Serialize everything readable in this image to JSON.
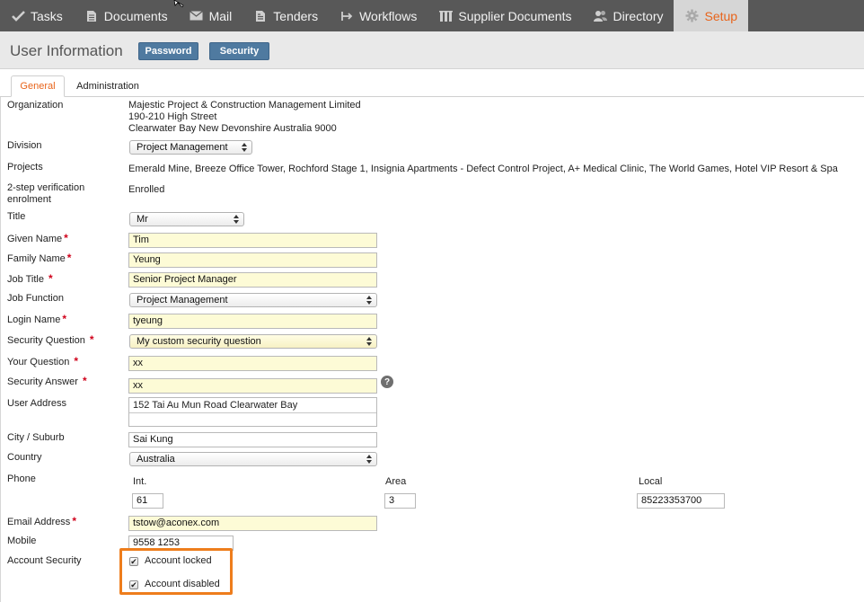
{
  "nav": {
    "items": [
      {
        "label": "Tasks",
        "icon": "check-icon"
      },
      {
        "label": "Documents",
        "icon": "document-icon"
      },
      {
        "label": "Mail",
        "icon": "mail-icon"
      },
      {
        "label": "Tenders",
        "icon": "tender-icon"
      },
      {
        "label": "Workflows",
        "icon": "workflow-icon"
      },
      {
        "label": "Supplier Documents",
        "icon": "supplier-documents-icon"
      },
      {
        "label": "Directory",
        "icon": "people-icon"
      },
      {
        "label": "Setup",
        "icon": "gear-icon",
        "active": true
      }
    ]
  },
  "header": {
    "title": "User Information",
    "password_btn": "Password",
    "security_btn": "Security"
  },
  "tabs": {
    "general": "General",
    "administration": "Administration"
  },
  "form": {
    "organization_label": "Organization",
    "organization_name": "Majestic Project & Construction Management Limited",
    "organization_address1": "190-210 High Street",
    "organization_address2": "Clearwater Bay New Devonshire Australia 9000",
    "division_label": "Division",
    "division_value": "Project Management",
    "projects_label": "Projects",
    "projects_value": "Emerald Mine, Breeze Office Tower, Rochford Stage 1, Insignia Apartments - Defect Control Project, A+ Medical Clinic, The World Games, Hotel VIP Resort & Spa",
    "twostep_label_line1": "2-step verification",
    "twostep_label_line2": "enrolment",
    "twostep_value": "Enrolled",
    "title_label": "Title",
    "title_value": "Mr",
    "given_name_label": "Given Name",
    "given_name_value": "Tim",
    "family_name_label": "Family Name",
    "family_name_value": "Yeung",
    "job_title_label": "Job Title",
    "job_title_value": "Senior Project Manager",
    "job_function_label": "Job Function",
    "job_function_value": "Project Management",
    "login_name_label": "Login Name",
    "login_name_value": "tyeung",
    "security_question_label": "Security Question",
    "security_question_value": "My custom security question",
    "your_question_label": "Your Question",
    "your_question_value": "xx",
    "security_answer_label": "Security Answer",
    "security_answer_value": "xx",
    "help_glyph": "?",
    "user_address_label": "User Address",
    "user_address_line1": "152 Tai Au Mun Road Clearwater Bay",
    "city_label": "City / Suburb",
    "city_value": "Sai Kung",
    "country_label": "Country",
    "country_value": "Australia",
    "phone_label": "Phone",
    "phone_int_label": "Int.",
    "phone_int_value": "61",
    "phone_area_label": "Area",
    "phone_area_value": "3",
    "phone_local_label": "Local",
    "phone_local_value": "85223353700",
    "email_label": "Email Address",
    "email_value": "tstow@aconex.com",
    "mobile_label": "Mobile",
    "mobile_value": "9558 1253",
    "account_security_label": "Account Security",
    "account_locked_label": "Account locked",
    "account_disabled_label": "Account disabled",
    "required_mark": "*",
    "check_mark": "✔"
  },
  "colors": {
    "nav_bg": "#585858",
    "accent": "#e8641b",
    "button_blue": "#4f7aa0",
    "required_field_bg": "#fdfbd6",
    "highlight_box": "#ee7d1c"
  }
}
